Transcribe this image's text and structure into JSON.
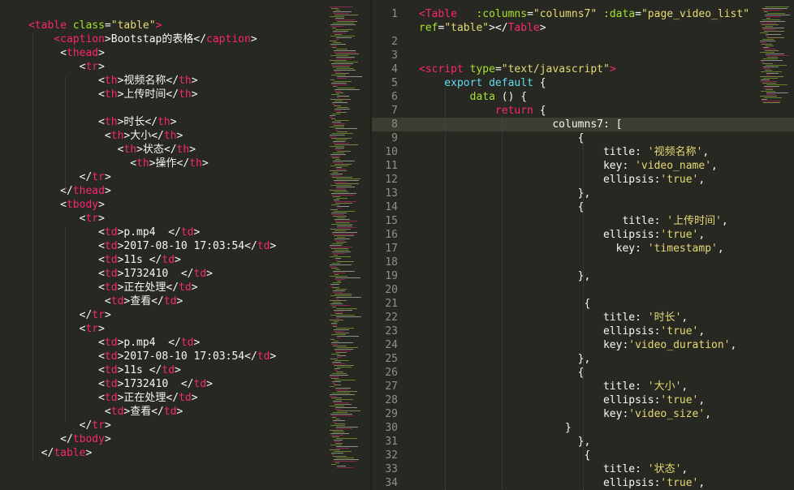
{
  "left_pane": {
    "lines": [
      [
        [
          "t",
          "<table "
        ],
        [
          "a",
          "class"
        ],
        [
          "p",
          "="
        ],
        [
          "s",
          "\"table\""
        ],
        [
          "t",
          ">"
        ]
      ],
      [
        [
          "t",
          "    <caption"
        ],
        [
          "p",
          ">Bootstap的表格</"
        ],
        [
          "t",
          "caption"
        ],
        [
          "p",
          ">"
        ]
      ],
      [
        [
          "p",
          "     <"
        ],
        [
          "t",
          "thead"
        ],
        [
          "p",
          ">"
        ]
      ],
      [
        [
          "p",
          "        <"
        ],
        [
          "t",
          "tr"
        ],
        [
          "p",
          ">"
        ]
      ],
      [
        [
          "p",
          "           <"
        ],
        [
          "t",
          "th"
        ],
        [
          "p",
          ">视频名称</"
        ],
        [
          "t",
          "th"
        ],
        [
          "p",
          ">"
        ]
      ],
      [
        [
          "p",
          "           <"
        ],
        [
          "t",
          "th"
        ],
        [
          "p",
          ">上传时间</"
        ],
        [
          "t",
          "th"
        ],
        [
          "p",
          ">"
        ]
      ],
      [],
      [
        [
          "p",
          "           <"
        ],
        [
          "t",
          "th"
        ],
        [
          "p",
          ">时长</"
        ],
        [
          "t",
          "th"
        ],
        [
          "p",
          ">"
        ]
      ],
      [
        [
          "p",
          "            <"
        ],
        [
          "t",
          "th"
        ],
        [
          "p",
          ">大小</"
        ],
        [
          "t",
          "th"
        ],
        [
          "p",
          ">"
        ]
      ],
      [
        [
          "p",
          "              <"
        ],
        [
          "t",
          "th"
        ],
        [
          "p",
          ">状态</"
        ],
        [
          "t",
          "th"
        ],
        [
          "p",
          ">"
        ]
      ],
      [
        [
          "p",
          "                <"
        ],
        [
          "t",
          "th"
        ],
        [
          "p",
          ">操作</"
        ],
        [
          "t",
          "th"
        ],
        [
          "p",
          ">"
        ]
      ],
      [
        [
          "p",
          "        </"
        ],
        [
          "t",
          "tr"
        ],
        [
          "p",
          ">"
        ]
      ],
      [
        [
          "p",
          "     </"
        ],
        [
          "t",
          "thead"
        ],
        [
          "p",
          ">"
        ]
      ],
      [
        [
          "p",
          "     <"
        ],
        [
          "t",
          "tbody"
        ],
        [
          "p",
          ">"
        ]
      ],
      [
        [
          "p",
          "        <"
        ],
        [
          "t",
          "tr"
        ],
        [
          "p",
          ">"
        ]
      ],
      [
        [
          "p",
          "           <"
        ],
        [
          "t",
          "td"
        ],
        [
          "p",
          ">p.mp4  </"
        ],
        [
          "t",
          "td"
        ],
        [
          "p",
          ">"
        ]
      ],
      [
        [
          "p",
          "           <"
        ],
        [
          "t",
          "td"
        ],
        [
          "p",
          ">2017-08-10 17:03:54</"
        ],
        [
          "t",
          "td"
        ],
        [
          "p",
          ">"
        ]
      ],
      [
        [
          "p",
          "           <"
        ],
        [
          "t",
          "td"
        ],
        [
          "p",
          ">11s </"
        ],
        [
          "t",
          "td"
        ],
        [
          "p",
          ">"
        ]
      ],
      [
        [
          "p",
          "           <"
        ],
        [
          "t",
          "td"
        ],
        [
          "p",
          ">1732410  </"
        ],
        [
          "t",
          "td"
        ],
        [
          "p",
          ">"
        ]
      ],
      [
        [
          "p",
          "           <"
        ],
        [
          "t",
          "td"
        ],
        [
          "p",
          ">正在处理</"
        ],
        [
          "t",
          "td"
        ],
        [
          "p",
          ">"
        ]
      ],
      [
        [
          "p",
          "            <"
        ],
        [
          "t",
          "td"
        ],
        [
          "p",
          ">查看</"
        ],
        [
          "t",
          "td"
        ],
        [
          "p",
          ">"
        ]
      ],
      [
        [
          "p",
          "        </"
        ],
        [
          "t",
          "tr"
        ],
        [
          "p",
          ">"
        ]
      ],
      [
        [
          "p",
          "        <"
        ],
        [
          "t",
          "tr"
        ],
        [
          "p",
          ">"
        ]
      ],
      [
        [
          "p",
          "           <"
        ],
        [
          "t",
          "td"
        ],
        [
          "p",
          ">p.mp4  </"
        ],
        [
          "t",
          "td"
        ],
        [
          "p",
          ">"
        ]
      ],
      [
        [
          "p",
          "           <"
        ],
        [
          "t",
          "td"
        ],
        [
          "p",
          ">2017-08-10 17:03:54</"
        ],
        [
          "t",
          "td"
        ],
        [
          "p",
          ">"
        ]
      ],
      [
        [
          "p",
          "           <"
        ],
        [
          "t",
          "td"
        ],
        [
          "p",
          ">11s </"
        ],
        [
          "t",
          "td"
        ],
        [
          "p",
          ">"
        ]
      ],
      [
        [
          "p",
          "           <"
        ],
        [
          "t",
          "td"
        ],
        [
          "p",
          ">1732410  </"
        ],
        [
          "t",
          "td"
        ],
        [
          "p",
          ">"
        ]
      ],
      [
        [
          "p",
          "           <"
        ],
        [
          "t",
          "td"
        ],
        [
          "p",
          ">正在处理</"
        ],
        [
          "t",
          "td"
        ],
        [
          "p",
          ">"
        ]
      ],
      [
        [
          "p",
          "            <"
        ],
        [
          "t",
          "td"
        ],
        [
          "p",
          ">查看</"
        ],
        [
          "t",
          "td"
        ],
        [
          "p",
          ">"
        ]
      ],
      [
        [
          "p",
          "        </"
        ],
        [
          "t",
          "tr"
        ],
        [
          "p",
          ">"
        ]
      ],
      [
        [
          "p",
          "     </"
        ],
        [
          "t",
          "tbody"
        ],
        [
          "p",
          ">"
        ]
      ],
      [
        [
          "p",
          "  </"
        ],
        [
          "t",
          "table"
        ],
        [
          "p",
          ">"
        ]
      ]
    ]
  },
  "right_pane": {
    "line_numbers": [
      "1",
      "",
      "2",
      "3",
      "4",
      "5",
      "6",
      "7",
      "8",
      "9",
      "10",
      "11",
      "12",
      "13",
      "14",
      "15",
      "16",
      "17",
      "18",
      "19",
      "20",
      "21",
      "22",
      "23",
      "24",
      "25",
      "26",
      "27",
      "28",
      "29",
      "30",
      "31",
      "32",
      "33",
      "34"
    ],
    "current_line": "8",
    "lines": [
      [
        [
          "t",
          "<Table "
        ],
        [
          "a",
          "  :columns"
        ],
        [
          "p",
          "="
        ],
        [
          "s",
          "\"columns7\""
        ],
        [
          "a",
          " :data"
        ],
        [
          "p",
          "="
        ],
        [
          "s",
          "\"page_video_list\""
        ]
      ],
      [
        [
          "a",
          "ref"
        ],
        [
          "p",
          "="
        ],
        [
          "s",
          "\"table\""
        ],
        [
          "p",
          "></"
        ],
        [
          "t",
          "Table"
        ],
        [
          "p",
          ">"
        ]
      ],
      [],
      [],
      [
        [
          "t",
          "<script "
        ],
        [
          "a",
          "type"
        ],
        [
          "p",
          "="
        ],
        [
          "s",
          "\"text/javascript\""
        ],
        [
          "t",
          ">"
        ]
      ],
      [
        [
          "k",
          "    export "
        ],
        [
          "k",
          "default"
        ],
        [
          "p",
          " {"
        ]
      ],
      [
        [
          "a",
          "        data"
        ],
        [
          "p",
          " () {"
        ]
      ],
      [
        [
          "t",
          "            return"
        ],
        [
          "p",
          " {"
        ]
      ],
      [
        [
          "p",
          "                     columns7: ["
        ]
      ],
      [
        [
          "p",
          "                         {"
        ]
      ],
      [
        [
          "p",
          "                             title: "
        ],
        [
          "s",
          "'视频名称'"
        ],
        [
          "p",
          ","
        ]
      ],
      [
        [
          "p",
          "                             key: "
        ],
        [
          "s",
          "'video_name'"
        ],
        [
          "p",
          ","
        ]
      ],
      [
        [
          "p",
          "                             ellipsis:"
        ],
        [
          "s",
          "'true'"
        ],
        [
          "p",
          ","
        ]
      ],
      [
        [
          "p",
          "                         },"
        ]
      ],
      [
        [
          "p",
          "                         {"
        ]
      ],
      [
        [
          "p",
          "                                title: "
        ],
        [
          "s",
          "'上传时间'"
        ],
        [
          "p",
          ","
        ]
      ],
      [
        [
          "p",
          "                             ellipsis:"
        ],
        [
          "s",
          "'true'"
        ],
        [
          "p",
          ","
        ]
      ],
      [
        [
          "p",
          "                               key: "
        ],
        [
          "s",
          "'timestamp'"
        ],
        [
          "p",
          ","
        ]
      ],
      [],
      [
        [
          "p",
          "                         },"
        ]
      ],
      [],
      [
        [
          "p",
          "                          {"
        ]
      ],
      [
        [
          "p",
          "                             title: "
        ],
        [
          "s",
          "'时长'"
        ],
        [
          "p",
          ","
        ]
      ],
      [
        [
          "p",
          "                             ellipsis:"
        ],
        [
          "s",
          "'true'"
        ],
        [
          "p",
          ","
        ]
      ],
      [
        [
          "p",
          "                             key:"
        ],
        [
          "s",
          "'video_duration'"
        ],
        [
          "p",
          ","
        ]
      ],
      [
        [
          "p",
          "                         },"
        ]
      ],
      [
        [
          "p",
          "                         {"
        ]
      ],
      [
        [
          "p",
          "                             title: "
        ],
        [
          "s",
          "'大小'"
        ],
        [
          "p",
          ","
        ]
      ],
      [
        [
          "p",
          "                             ellipsis:"
        ],
        [
          "s",
          "'true'"
        ],
        [
          "p",
          ","
        ]
      ],
      [
        [
          "p",
          "                             key:"
        ],
        [
          "s",
          "'video_size'"
        ],
        [
          "p",
          ","
        ]
      ],
      [
        [
          "p",
          "                       }"
        ]
      ],
      [
        [
          "p",
          "                         },"
        ]
      ],
      [
        [
          "p",
          "                          {"
        ]
      ],
      [
        [
          "p",
          "                             title: "
        ],
        [
          "s",
          "'状态'"
        ],
        [
          "p",
          ","
        ]
      ],
      [
        [
          "p",
          "                             ellipsis:"
        ],
        [
          "s",
          "'true'"
        ],
        [
          "p",
          ","
        ]
      ]
    ]
  },
  "colors": {
    "background": "#272822",
    "tag": "#f92672",
    "string": "#e6db74",
    "attribute": "#a6e22e",
    "keyword": "#66d9ef",
    "plain": "#f8f8f2",
    "gutter_text": "#8f908a",
    "current_line": "#3e3d32"
  }
}
